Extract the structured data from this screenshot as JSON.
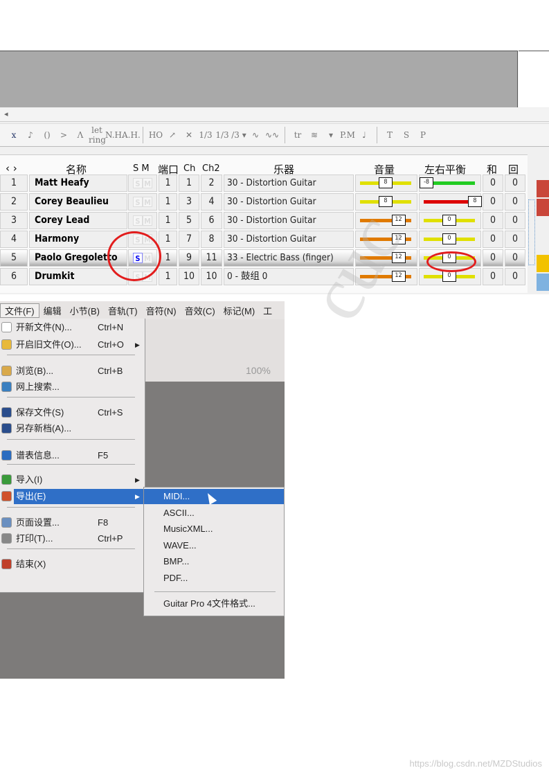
{
  "track_panel": {
    "toolbar_icons": [
      "x",
      "♪",
      "()",
      ">",
      "Λ",
      "let ring",
      "N.H.",
      "A.H.",
      "|",
      "HO",
      "↗",
      "✕",
      "1/3",
      "1/3",
      "/3 ▾",
      "∿",
      "∿∿",
      "|",
      "tr",
      "≋",
      "▾",
      "P.M",
      "♩",
      "|",
      "T",
      "S",
      "P"
    ],
    "headers": {
      "nav": "‹ ›",
      "name": "名称",
      "sm": "S M",
      "port": "端口",
      "ch": "Ch",
      "ch2": "Ch2",
      "instrument": "乐器",
      "volume": "音量",
      "pan": "左右平衡",
      "chorus": "和",
      "reverb": "回"
    },
    "rows": [
      {
        "index": "1",
        "name": "Matt Heafy",
        "solo": false,
        "port": "1",
        "ch": "1",
        "ch2": "2",
        "instrument": "30 - Distortion Guitar",
        "volume": "8",
        "pan": "-8",
        "chorus": "0",
        "reverb": "0",
        "track_color": "#c9463a"
      },
      {
        "index": "2",
        "name": "Corey Beaulieu",
        "solo": false,
        "port": "1",
        "ch": "3",
        "ch2": "4",
        "instrument": "30 - Distortion Guitar",
        "volume": "8",
        "pan": "8",
        "chorus": "0",
        "reverb": "0",
        "track_color": "#c9463a"
      },
      {
        "index": "3",
        "name": "Corey Lead",
        "solo": false,
        "port": "1",
        "ch": "5",
        "ch2": "6",
        "instrument": "30 - Distortion Guitar",
        "volume": "12",
        "pan": "0",
        "chorus": "0",
        "reverb": "0",
        "track_color": "#f0f0f0"
      },
      {
        "index": "4",
        "name": "Harmony",
        "solo": false,
        "port": "1",
        "ch": "7",
        "ch2": "8",
        "instrument": "30 - Distortion Guitar",
        "volume": "12",
        "pan": "0",
        "chorus": "0",
        "reverb": "0",
        "track_color": "#f0f0f0"
      },
      {
        "index": "5",
        "name": "Paolo Gregoletto",
        "solo": true,
        "selected": true,
        "port": "1",
        "ch": "9",
        "ch2": "11",
        "instrument": "33 - Electric Bass (finger)",
        "volume": "12",
        "pan": "0",
        "chorus": "0",
        "reverb": "0",
        "track_color": "#f2c200"
      },
      {
        "index": "6",
        "name": "Drumkit",
        "solo": false,
        "port": "1",
        "ch": "10",
        "ch2": "10",
        "instrument": "0 - 鼓组 0",
        "volume": "12",
        "pan": "0",
        "chorus": "0",
        "reverb": "0",
        "track_color": "#7fb2e0"
      }
    ],
    "sm_labels": {
      "s": "S",
      "m": "M"
    },
    "colors": {
      "annotation": "#e21d1d",
      "volume_8": "#e0e000",
      "volume_12": "#e07a00",
      "pan_left": "#22cc22",
      "pan_right": "#dd0000",
      "pan_center": "#e0e000"
    }
  },
  "menu_screenshot": {
    "menubar": [
      "文件(F)",
      "编辑",
      "小节(B)",
      "音轨(T)",
      "音符(N)",
      "音效(C)",
      "标记(M)",
      "工"
    ],
    "file_menu": [
      {
        "label": "开新文件(N)...",
        "shortcut": "Ctrl+N",
        "icon": "new-file-icon"
      },
      {
        "label": "开启旧文件(O)...",
        "shortcut": "Ctrl+O",
        "icon": "folder-icon",
        "submenu": true
      },
      {
        "label": "浏览(B)...",
        "shortcut": "Ctrl+B",
        "icon": "browse-icon"
      },
      {
        "label": "网上搜索...",
        "shortcut": "",
        "icon": "web-search-icon"
      },
      {
        "label": "保存文件(S)",
        "shortcut": "Ctrl+S",
        "icon": "save-icon"
      },
      {
        "label": "另存新档(A)...",
        "shortcut": "",
        "icon": "save-as-icon"
      },
      {
        "label": "谱表信息...",
        "shortcut": "F5",
        "icon": "info-icon"
      },
      {
        "label": "导入(I)",
        "shortcut": "",
        "icon": "import-icon",
        "submenu": true
      },
      {
        "label": "导出(E)",
        "shortcut": "",
        "icon": "export-icon",
        "submenu": true,
        "highlighted": true
      },
      {
        "label": "页面设置...",
        "shortcut": "F8",
        "icon": "page-setup-icon"
      },
      {
        "label": "打印(T)...",
        "shortcut": "Ctrl+P",
        "icon": "print-icon"
      },
      {
        "label": "结束(X)",
        "shortcut": "",
        "icon": "exit-icon"
      }
    ],
    "export_submenu": [
      "MIDI...",
      "ASCII...",
      "MusicXML...",
      "WAVE...",
      "BMP...",
      "PDF...",
      "Guitar Pro 4文件格式..."
    ],
    "toolbar_zoom": "100%"
  },
  "watermark": "https://blog.csdn.net/MZDStudios"
}
